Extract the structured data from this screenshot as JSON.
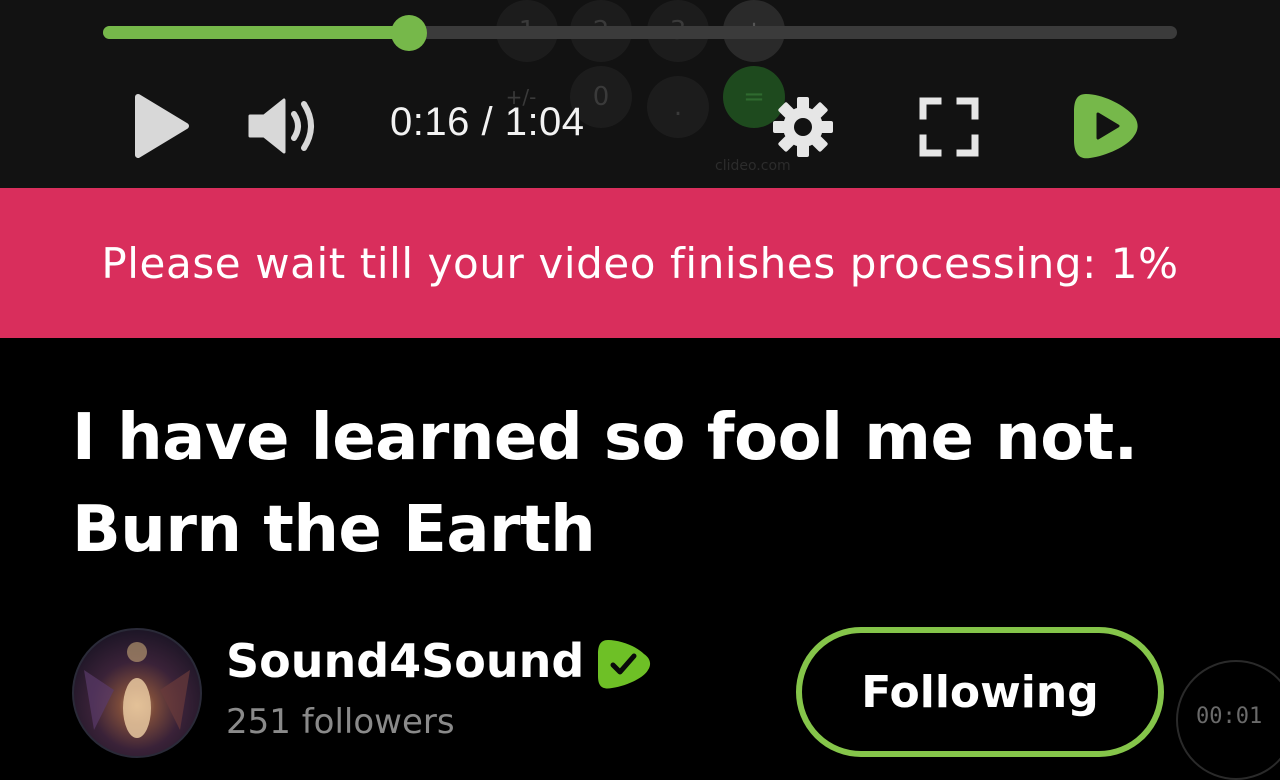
{
  "player": {
    "progress_fraction": 0.285,
    "time_display": "0:16 / 1:04",
    "colors": {
      "accent": "#76b84a",
      "track": "#3b3b3b",
      "bg": "#121212"
    },
    "ghost_overlay": {
      "keys": [
        "1",
        "2",
        "3",
        "+",
        "+/-",
        "0",
        ".",
        "="
      ],
      "watermark": "clideo.com"
    }
  },
  "banner": {
    "text": "Please wait till your video finishes processing: 1%",
    "color": "#d92e5c"
  },
  "video": {
    "title_line1": "I have learned so fool me not.",
    "title_line2": "Burn the Earth"
  },
  "channel": {
    "name": "Sound4Sound",
    "followers": "251 followers",
    "verified_color": "#6ec026",
    "follow_label": "Following",
    "follow_border": "#85c54a"
  },
  "timer": {
    "text": "00:01"
  }
}
